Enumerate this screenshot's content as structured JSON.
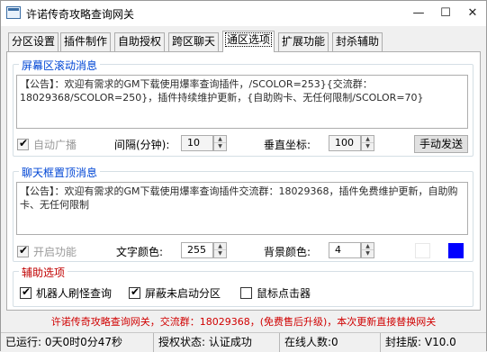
{
  "window": {
    "title": "许诺传奇攻略查询网关",
    "controls": {
      "minimize": "—",
      "maximize": "☐",
      "close": "✕"
    }
  },
  "tabs": [
    {
      "label": "分区设置"
    },
    {
      "label": "插件制作"
    },
    {
      "label": "自助授权"
    },
    {
      "label": "跨区聊天"
    },
    {
      "label": "通区选项",
      "active": true
    },
    {
      "label": "扩展功能"
    },
    {
      "label": "封杀辅助"
    }
  ],
  "screen_scroll": {
    "title": "屏幕区滚动消息",
    "message": "【公告】：欢迎有需求的GM下载使用爆率查询插件，/SCOLOR=253}{交流群：18029368/SCOLOR=250}，插件持续维护更新，{自助购卡、无任何限制/SCOLOR=70}",
    "auto_broadcast": {
      "label": "自动广播",
      "checked": true,
      "enabled": false
    },
    "interval_label": "间隔(分钟):",
    "interval_value": "10",
    "vertical_label": "垂直坐标:",
    "vertical_value": "100",
    "manual_send": "手动发送"
  },
  "chat_top": {
    "title": "聊天框置顶消息",
    "message": "【公告】：欢迎有需求的GM下载使用爆率查询插件交流群：18029368，插件免费维护更新，自助购卡、无任何限制",
    "enable": {
      "label": "开启功能",
      "checked": true,
      "enabled": false
    },
    "text_color_label": "文字颜色:",
    "text_color_value": "255",
    "bg_color_label": "背景颜色:",
    "bg_color_value": "4",
    "text_swatch_color": "#ffffff",
    "bg_swatch_color": "#0000ff"
  },
  "aux": {
    "title": "辅助选项",
    "options": [
      {
        "label": "机器人刷怪查询",
        "checked": true
      },
      {
        "label": "屏蔽未启动分区",
        "checked": true
      },
      {
        "label": "鼠标点击器",
        "checked": false
      }
    ]
  },
  "footer": "许诺传奇攻略查询网关，交流群：18029368，(免费售后升级)，本次更新直接替换网关",
  "status": {
    "uptime": "已运行: 0天0时0分47秒",
    "auth": "授权状态: 认证成功",
    "online": "在线人数:0",
    "version": "封挂版: V10.0"
  },
  "colors": {
    "group_title": "#0046d5",
    "aux_title": "#c00000",
    "footer": "#d00000"
  }
}
